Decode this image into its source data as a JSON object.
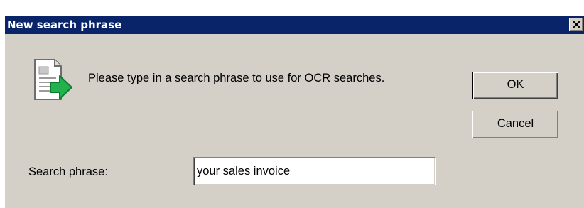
{
  "dialog": {
    "title": "New search phrase",
    "message": "Please type in a search phrase to use for OCR searches.",
    "icon": "document-arrow-icon",
    "close_icon": "close-icon"
  },
  "buttons": {
    "ok_label": "OK",
    "cancel_label": "Cancel"
  },
  "search_field": {
    "label": "Search phrase:",
    "value": "your sales invoice",
    "placeholder": ""
  },
  "colors": {
    "titlebar": "#0a246a",
    "dialog_face": "#d4d0c8",
    "arrow": "#22b14c"
  }
}
